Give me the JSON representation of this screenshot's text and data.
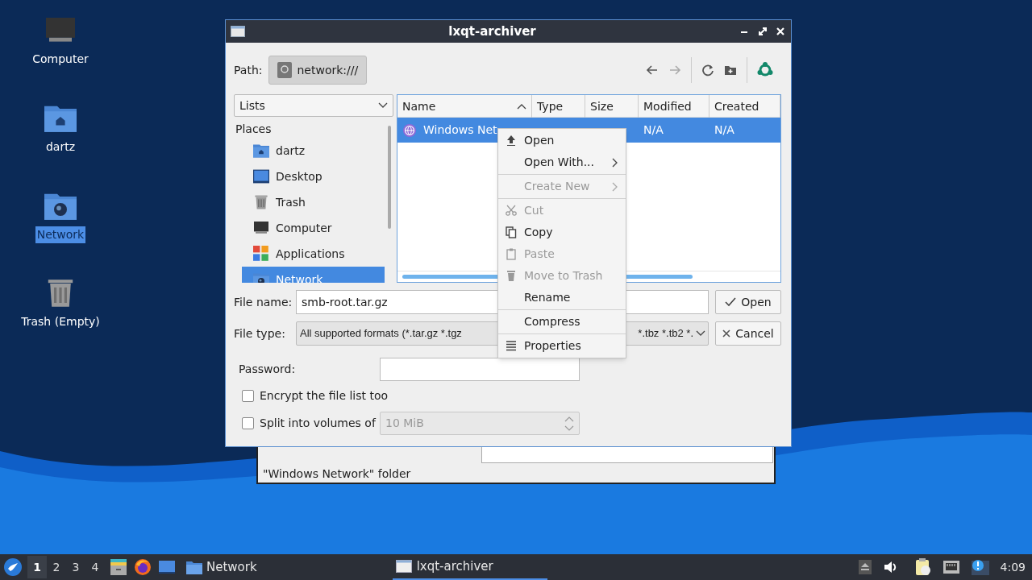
{
  "desktop_icons": [
    {
      "kind": "computer",
      "label": "Computer",
      "selected": false
    },
    {
      "kind": "home",
      "label": "dartz",
      "selected": false
    },
    {
      "kind": "network",
      "label": "Network",
      "selected": true
    },
    {
      "kind": "trash",
      "label": "Trash (Empty)",
      "selected": false
    }
  ],
  "background_window": {
    "status_text": "\"Windows Network\" folder"
  },
  "dialog": {
    "title": "lxqt-archiver",
    "path_label": "Path:",
    "path": "network:///",
    "places_combo": "Lists",
    "places_heading": "Places",
    "places": [
      {
        "kind": "home",
        "label": "dartz",
        "selected": false
      },
      {
        "kind": "desktop",
        "label": "Desktop",
        "selected": false
      },
      {
        "kind": "trash",
        "label": "Trash",
        "selected": false
      },
      {
        "kind": "computer",
        "label": "Computer",
        "selected": false
      },
      {
        "kind": "apps",
        "label": "Applications",
        "selected": false
      },
      {
        "kind": "network",
        "label": "Network",
        "selected": true
      }
    ],
    "columns": [
      {
        "label": "Name",
        "sorted": true
      },
      {
        "label": "Type",
        "sorted": false
      },
      {
        "label": "Size",
        "sorted": false
      },
      {
        "label": "Modified",
        "sorted": false
      },
      {
        "label": "Created",
        "sorted": false
      }
    ],
    "rows": [
      {
        "name": "Windows Net",
        "modified": "N/A",
        "created": "N/A",
        "selected": true
      }
    ],
    "file_name_label": "File name:",
    "file_name": "smb-root.tar.gz",
    "file_type_label": "File type:",
    "file_type_left": "All supported formats (*.tar.gz *.tgz",
    "file_type_right": "*.tbz *.tb2 *.",
    "open_button": "Open",
    "cancel_button": "Cancel",
    "password_label": "Password:",
    "encrypt": {
      "label": "Encrypt the file list too",
      "checked": false
    },
    "split": {
      "label": "Split into volumes of",
      "checked": false,
      "value": "10 MiB"
    }
  },
  "context_menu": [
    {
      "kind": "item",
      "label": "Open",
      "disabled": false,
      "submenu": false
    },
    {
      "kind": "item",
      "label": "Open With...",
      "disabled": false,
      "submenu": true
    },
    {
      "kind": "separator"
    },
    {
      "kind": "item",
      "label": "Create New",
      "disabled": true,
      "submenu": true
    },
    {
      "kind": "separator"
    },
    {
      "kind": "item",
      "label": "Cut",
      "disabled": true,
      "submenu": false
    },
    {
      "kind": "item",
      "label": "Copy",
      "disabled": false,
      "submenu": false
    },
    {
      "kind": "item",
      "label": "Paste",
      "disabled": true,
      "submenu": false
    },
    {
      "kind": "item",
      "label": "Move to Trash",
      "disabled": true,
      "submenu": false
    },
    {
      "kind": "item",
      "label": "Rename",
      "disabled": false,
      "submenu": false
    },
    {
      "kind": "separator"
    },
    {
      "kind": "item",
      "label": "Compress",
      "disabled": false,
      "submenu": false
    },
    {
      "kind": "separator"
    },
    {
      "kind": "item",
      "label": "Properties",
      "disabled": false,
      "submenu": false
    }
  ],
  "taskbar": {
    "workspaces": [
      {
        "label": "1",
        "selected": true
      },
      {
        "label": "2",
        "selected": false
      },
      {
        "label": "3",
        "selected": false
      },
      {
        "label": "4",
        "selected": false
      }
    ],
    "tasks": [
      {
        "label": "Network",
        "active": false
      },
      {
        "label": "lxqt-archiver",
        "active": true
      }
    ],
    "clock": "4:09"
  }
}
